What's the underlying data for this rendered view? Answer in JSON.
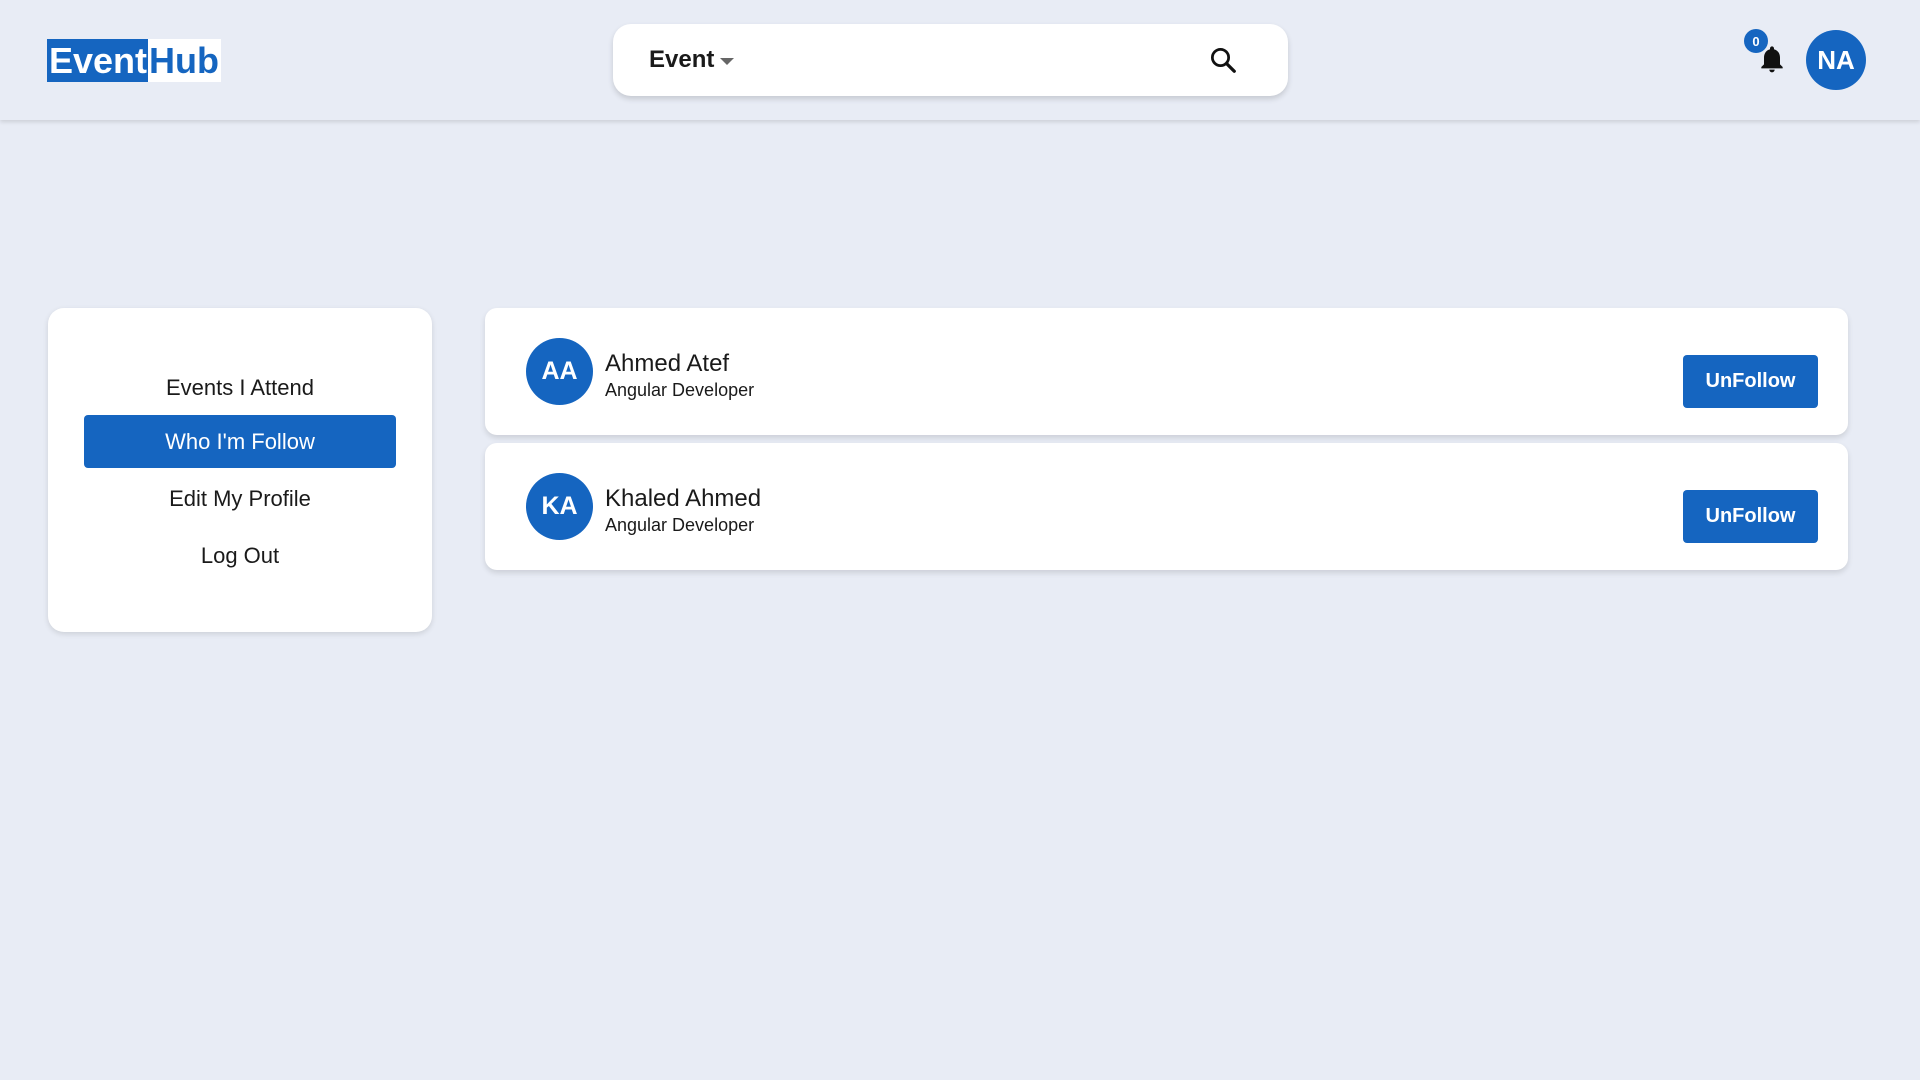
{
  "header": {
    "logo_part1": "Event",
    "logo_part2": "Hub",
    "search": {
      "category": "Event",
      "value": "",
      "placeholder": ""
    },
    "notifications_count": "0",
    "user_initials": "NA"
  },
  "sidebar": {
    "items": [
      {
        "label": "Events I Attend",
        "active": false
      },
      {
        "label": "Who I'm Follow",
        "active": true
      },
      {
        "label": "Edit My Profile",
        "active": false
      },
      {
        "label": "Log Out",
        "active": false
      }
    ]
  },
  "following": [
    {
      "initials": "AA",
      "name": "Ahmed Atef",
      "role": "Angular Developer",
      "button_label": "UnFollow"
    },
    {
      "initials": "KA",
      "name": "Khaled Ahmed",
      "role": "Angular Developer",
      "button_label": "UnFollow"
    }
  ],
  "colors": {
    "primary": "#1565c0",
    "background": "#e8ecf5",
    "card": "#ffffff"
  }
}
